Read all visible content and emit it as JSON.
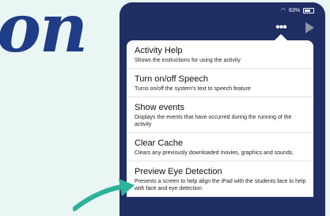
{
  "background_title": "on",
  "status_bar": {
    "battery_text": "63%"
  },
  "menu": {
    "items": [
      {
        "title": "Activity Help",
        "description": "Shows the instructions for using the activity"
      },
      {
        "title": "Turn on/off Speech",
        "description": "Turns on/off the system's text to speech feature"
      },
      {
        "title": "Show events",
        "description": "Displays the events that have occurred during the running of the activity"
      },
      {
        "title": "Clear Cache",
        "description": "Clears any previously downloaded movies, graphics and sounds."
      },
      {
        "title": "Preview Eye Detection",
        "description": "Presents a screen to help align the iPad with the students face to help with face and eye detection"
      }
    ]
  },
  "colors": {
    "background": "#e9f6f4",
    "title_text": "#1f3c86",
    "app_bar": "#1f2f63",
    "arrow": "#2cb39a"
  },
  "icons": [
    "wifi-icon",
    "battery-icon",
    "more-options-icon",
    "play-icon",
    "pointer-arrow"
  ]
}
